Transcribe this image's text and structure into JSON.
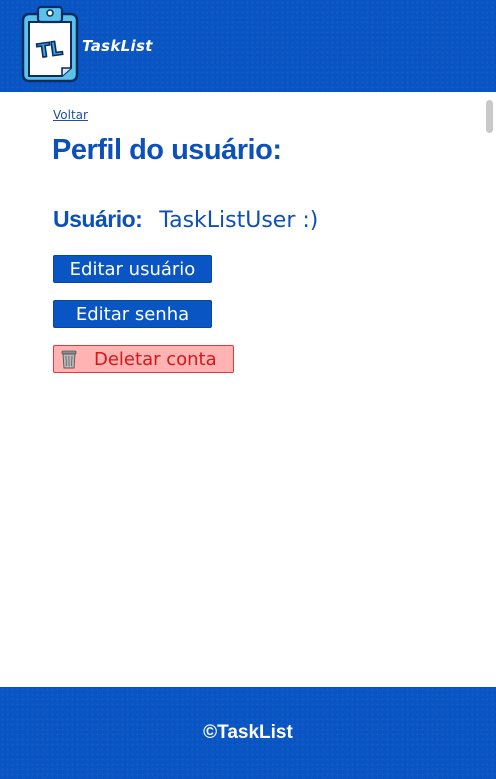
{
  "header": {
    "brand": "TaskList",
    "logo_icon": "clipboard-tl-logo",
    "logo_letters": "TL"
  },
  "nav": {
    "back_label": "Voltar"
  },
  "main": {
    "title": "Perfil do usuário:",
    "user_label": "Usuário:",
    "user_value": "TaskListUser :)",
    "buttons": {
      "edit_user": "Editar usuário",
      "edit_password": "Editar senha",
      "delete_account": "Deletar conta",
      "delete_icon": "trash-icon"
    }
  },
  "footer": {
    "copyright": "©TaskList"
  },
  "colors": {
    "primary": "#0a55c4",
    "title": "#0c50b8",
    "danger_bg": "#ffb3b3",
    "danger_text": "#d21818",
    "danger_border": "#e23a3a"
  }
}
